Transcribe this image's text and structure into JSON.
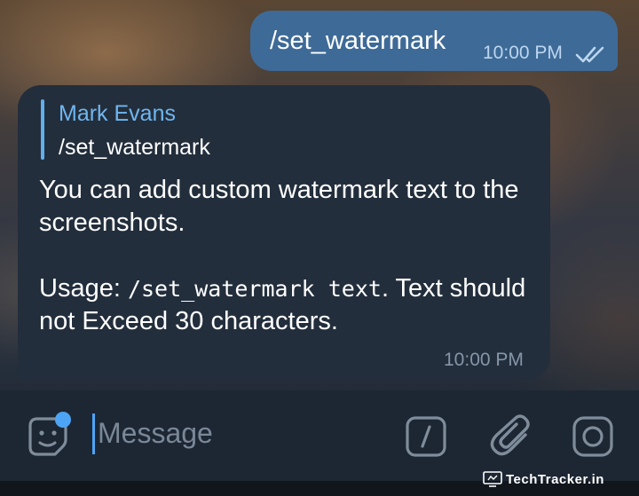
{
  "chat": {
    "outgoing": {
      "text": "/set_watermark",
      "time": "10:00 PM",
      "status_icon": "double-check-icon"
    },
    "incoming": {
      "reply_to": {
        "author": "Mark Evans",
        "text": "/set_watermark"
      },
      "paragraph1": "You can add custom watermark text to the screenshots.",
      "usage_prefix": "Usage: ",
      "usage_code": "/set_watermark text",
      "usage_suffix": ". Text should not Exceed 30 characters.",
      "time": "10:00 PM"
    }
  },
  "input_bar": {
    "placeholder": "Message",
    "icons": [
      "sticker-icon",
      "bot-command-icon",
      "attach-icon",
      "camera-icon"
    ]
  },
  "watermark": {
    "text": "TechTracker.in",
    "icon": "screen-icon"
  },
  "colors": {
    "outgoing_bubble": "#3e6a97",
    "incoming_bubble": "#232e3c",
    "accent": "#4ea4f4",
    "quote_name": "#6fb6ef"
  }
}
